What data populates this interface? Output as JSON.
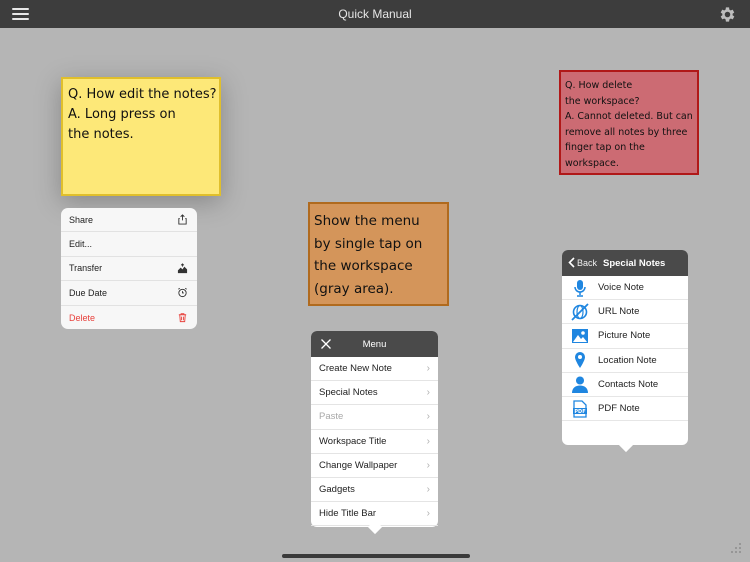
{
  "app": {
    "title": "Quick Manual"
  },
  "notes": {
    "yellow": {
      "lines": [
        "Q. How edit the notes?",
        "A. Long press on",
        "the notes."
      ]
    },
    "red": {
      "lines": [
        "Q. How delete",
        "the workspace?",
        "A. Cannot deleted. But can",
        "remove all notes by three",
        "finger tap on the",
        "workspace."
      ]
    },
    "orange": {
      "lines": [
        "Show the menu",
        "by single tap on",
        "the workspace",
        "(gray area)."
      ]
    }
  },
  "context_menu": {
    "items": [
      {
        "label": "Share",
        "icon": "share-icon"
      },
      {
        "label": "Edit...",
        "icon": ""
      },
      {
        "label": "Transfer",
        "icon": "transfer-icon"
      },
      {
        "label": "Due Date",
        "icon": "alarm-clock-icon"
      },
      {
        "label": "Delete",
        "icon": "trash-icon"
      }
    ]
  },
  "menu": {
    "title": "Menu",
    "items": [
      {
        "label": "Create New Note"
      },
      {
        "label": "Special Notes"
      },
      {
        "label": "Paste"
      },
      {
        "label": "Workspace Title"
      },
      {
        "label": "Change Wallpaper"
      },
      {
        "label": "Gadgets"
      },
      {
        "label": "Hide Title Bar"
      }
    ],
    "chevron": "›"
  },
  "special_notes": {
    "back_label": "Back",
    "title": "Special Notes",
    "items": [
      {
        "label": "Voice Note",
        "icon": "microphone-icon"
      },
      {
        "label": "URL Note",
        "icon": "url-icon"
      },
      {
        "label": "Picture Note",
        "icon": "picture-icon"
      },
      {
        "label": "Location Note",
        "icon": "location-pin-icon"
      },
      {
        "label": "Contacts Note",
        "icon": "contact-person-icon"
      },
      {
        "label": "PDF Note",
        "icon": "pdf-icon"
      }
    ]
  },
  "colors": {
    "accent_blue": "#1f86e0",
    "delete_red": "#e8413c",
    "titlebar": "#3d3d3d",
    "workspace": "#b5b5b5"
  }
}
